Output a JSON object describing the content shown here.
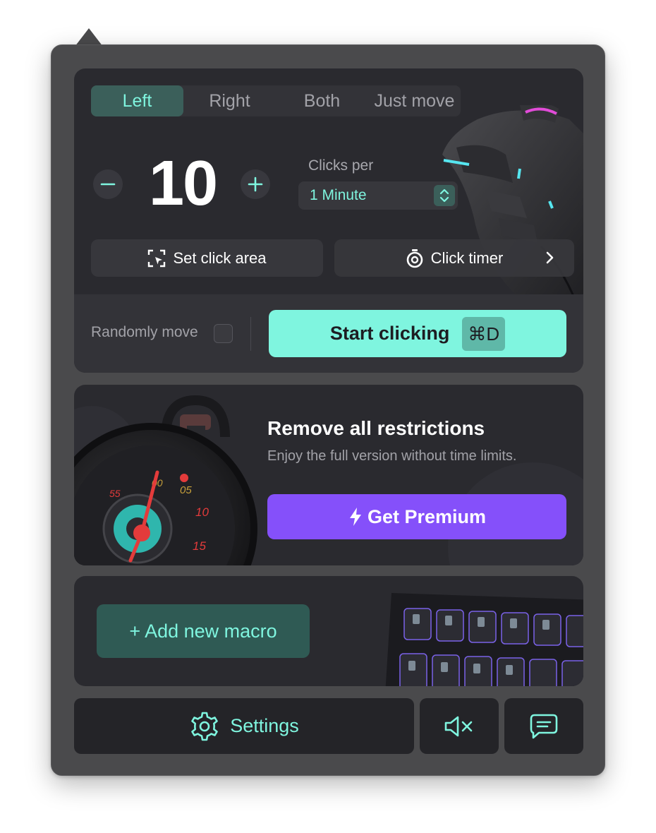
{
  "mode_tabs": [
    "Left",
    "Right",
    "Both",
    "Just move"
  ],
  "active_mode": "Left",
  "clicks": {
    "count": "10",
    "decrement_icon": "minus-icon",
    "increment_icon": "plus-icon",
    "rate_label": "Clicks per",
    "rate_value": "1 Minute"
  },
  "actions": {
    "set_area_label": "Set click area",
    "timer_label": "Click timer"
  },
  "start": {
    "random_move_label": "Randomly move",
    "random_move_checked": false,
    "button_label": "Start clicking",
    "shortcut": "⌘D"
  },
  "premium": {
    "title": "Remove all restrictions",
    "subtitle": "Enjoy the full version without time limits.",
    "button_label": "Get Premium"
  },
  "macro": {
    "button_label": "+ Add new macro"
  },
  "bottom_bar": {
    "settings_label": "Settings",
    "mute_icon": "speaker-muted-icon",
    "feedback_icon": "chat-icon"
  },
  "colors": {
    "accent": "#7ff5df",
    "accent_dark": "#3b5f5a",
    "premium": "#8550fa",
    "panel": "#4a4a4c",
    "card": "#2a2a2f"
  }
}
